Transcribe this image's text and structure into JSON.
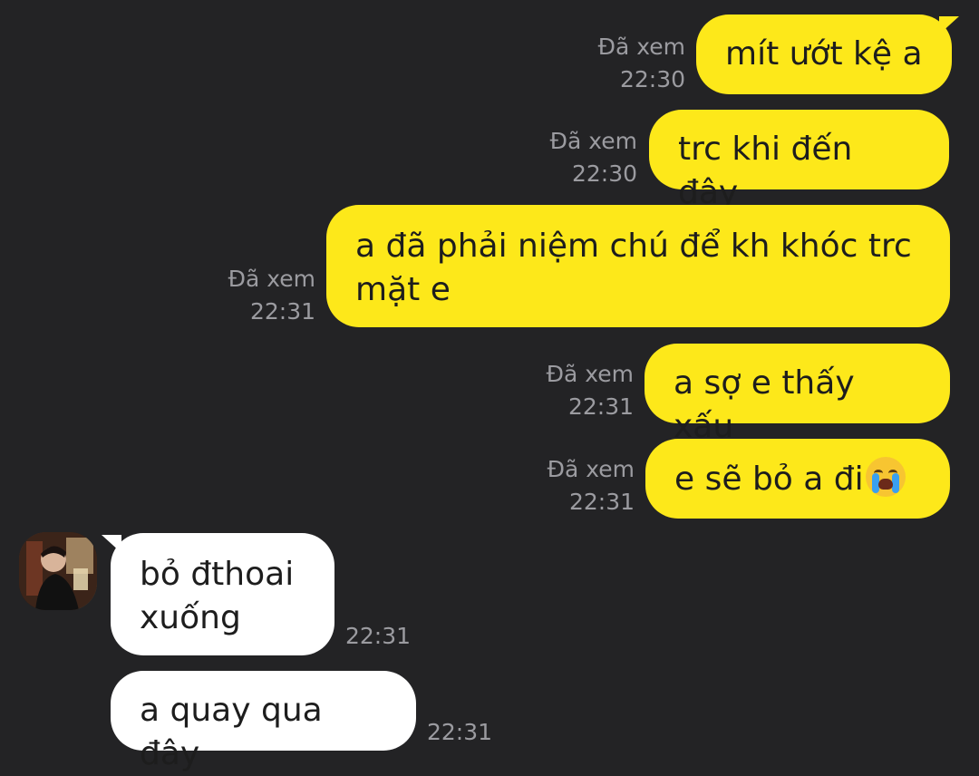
{
  "chat": {
    "messages": [
      {
        "direction": "out",
        "text": "mít ướt kệ a",
        "status": "Đã xem",
        "time": "22:30"
      },
      {
        "direction": "out",
        "text": "trc khi đến đây",
        "status": "Đã xem",
        "time": "22:30"
      },
      {
        "direction": "out",
        "text": "a đã phải niệm chú để kh khóc trc mặt e",
        "status": "Đã xem",
        "time": "22:31"
      },
      {
        "direction": "out",
        "text": "a sợ e thấy xấu",
        "status": "Đã xem",
        "time": "22:31"
      },
      {
        "direction": "out",
        "text": "e sẽ bỏ a đi",
        "emoji": "loudly-crying-face-emoji",
        "status": "Đã xem",
        "time": "22:31"
      },
      {
        "direction": "in",
        "text": "bỏ đthoai xuống",
        "time": "22:31"
      },
      {
        "direction": "in",
        "text": "a quay qua đây",
        "time": "22:31"
      }
    ]
  },
  "colors": {
    "background": "#232325",
    "outgoing_bubble": "#fde81a",
    "incoming_bubble": "#ffffff",
    "meta_text": "#9b9ba0"
  }
}
